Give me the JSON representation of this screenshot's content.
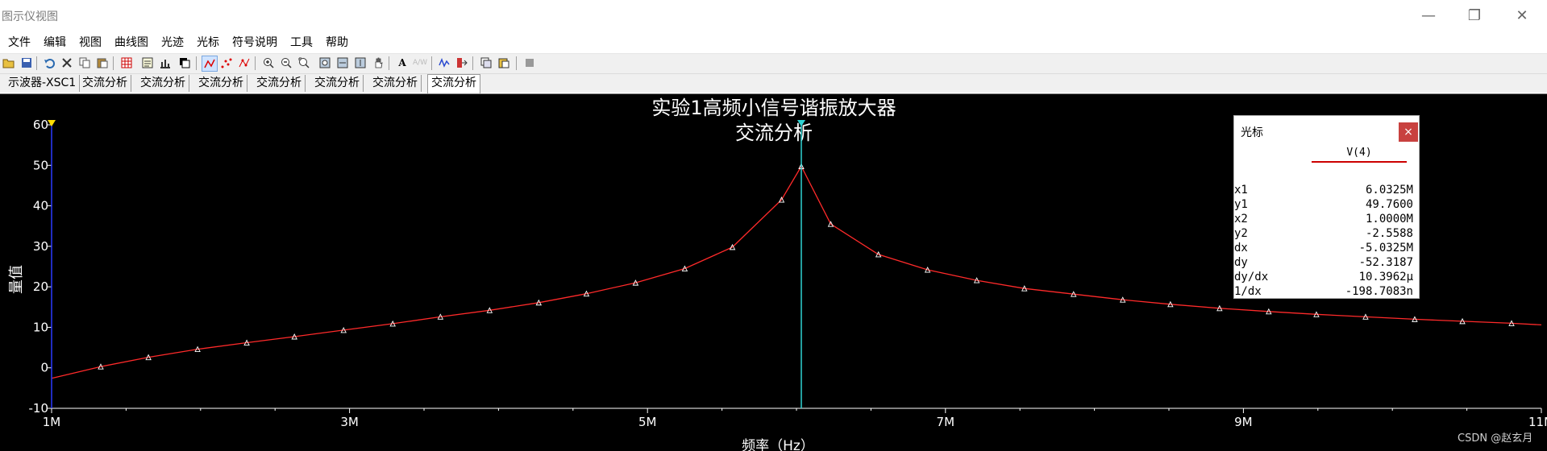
{
  "window": {
    "title": "图示仪视图",
    "minimize_glyph": "—",
    "restore_glyph": "❐",
    "close_glyph": "✕"
  },
  "menu": [
    "文件",
    "编辑",
    "视图",
    "曲线图",
    "光迹",
    "光标",
    "符号说明",
    "工具",
    "帮助"
  ],
  "toolbar_icons": [
    "open-icon",
    "save-icon",
    "undo-icon",
    "delete-icon",
    "copy-icon",
    "paste-icon",
    "grid-icon",
    "legend-icon",
    "data-bar-icon",
    "overlay-icon",
    "trace-line-icon",
    "trace-points-icon",
    "trace-markers-icon",
    "zoom-in-icon",
    "zoom-out-icon",
    "zoom-fit-icon",
    "zoom-area-icon",
    "zoom-x-icon",
    "zoom-y-icon",
    "pan-icon",
    "text-icon",
    "labels-icon",
    "fft-icon",
    "export-icon",
    "copy-graph-icon",
    "paste-graph-icon",
    "stop-icon"
  ],
  "tabs": [
    "示波器-XSC1",
    "交流分析",
    "交流分析",
    "交流分析",
    "交流分析",
    "交流分析",
    "交流分析",
    "交流分析"
  ],
  "active_tab": 7,
  "chart_data": {
    "type": "line",
    "title": "实验1高频小信号谐振放大器",
    "subtitle": "交流分析",
    "xlabel": "频率（Hz）",
    "ylabel": "量值",
    "xlim": [
      1000000,
      11000000
    ],
    "ylim": [
      -10,
      60
    ],
    "x_tick_labels": [
      "1M",
      "3M",
      "5M",
      "7M",
      "9M",
      "11M"
    ],
    "y_tick_labels": [
      "60",
      "50",
      "40",
      "30",
      "20",
      "10",
      "0",
      "-10"
    ],
    "grid": false,
    "background": "#000000",
    "line_color": "#ff2a2a",
    "marker": "triangle",
    "marker_color": "#ffffff",
    "series": [
      {
        "name": "V(4)",
        "x": [
          1000000,
          1330000,
          1650000,
          1980000,
          2310000,
          2630000,
          2960000,
          3290000,
          3610000,
          3940000,
          4270000,
          4590000,
          4920000,
          5250000,
          5570000,
          5900000,
          6032500,
          6230000,
          6550000,
          6880000,
          7210000,
          7530000,
          7860000,
          8190000,
          8510000,
          8840000,
          9170000,
          9490000,
          9820000,
          10150000,
          10470000,
          10800000,
          11000000
        ],
        "y": [
          -2.6,
          0.3,
          2.6,
          4.6,
          6.2,
          7.7,
          9.3,
          10.9,
          12.6,
          14.2,
          16.1,
          18.3,
          21.0,
          24.5,
          29.8,
          41.5,
          49.76,
          35.5,
          28.0,
          24.2,
          21.6,
          19.6,
          18.2,
          16.8,
          15.7,
          14.7,
          13.9,
          13.2,
          12.6,
          12.0,
          11.5,
          11.0,
          10.6
        ]
      }
    ],
    "cursors": [
      {
        "name": "cursor1",
        "x": 6032500,
        "color": "#2fd3d3"
      },
      {
        "name": "cursor2",
        "x": 1000000,
        "color": "#2a3aff"
      }
    ]
  },
  "cursor_panel": {
    "title": "光标",
    "close_label": "×",
    "column": "V(4)",
    "rows": [
      {
        "k": "x1",
        "v": "6.0325M"
      },
      {
        "k": "y1",
        "v": "49.7600"
      },
      {
        "k": "x2",
        "v": "1.0000M"
      },
      {
        "k": "y2",
        "v": "-2.5588"
      },
      {
        "k": "dx",
        "v": "-5.0325M"
      },
      {
        "k": "dy",
        "v": "-52.3187"
      },
      {
        "k": "dy/dx",
        "v": "10.3962µ"
      },
      {
        "k": "1/dx",
        "v": "-198.7083n"
      }
    ]
  },
  "watermark": "CSDN @赵玄月"
}
